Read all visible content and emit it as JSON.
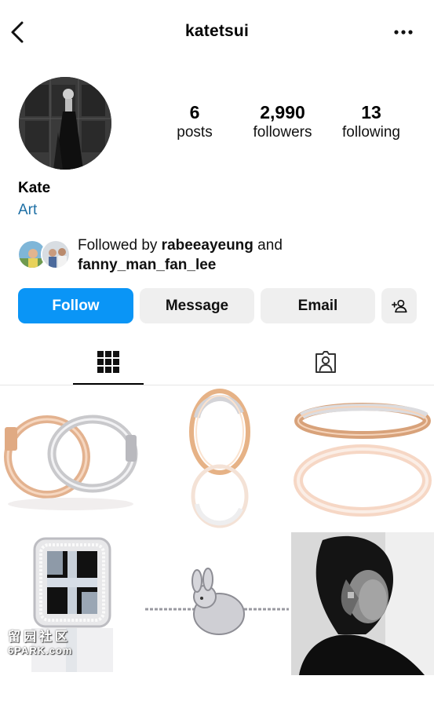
{
  "header": {
    "username": "katetsui",
    "back_icon": "chevron-left-icon",
    "more_icon": "more-horizontal-icon"
  },
  "profile": {
    "display_name": "Kate",
    "category": "Art",
    "stats": {
      "posts_count": "6",
      "posts_label": "posts",
      "followers_count": "2,990",
      "followers_label": "followers",
      "following_count": "13",
      "following_label": "following"
    }
  },
  "followed_by": {
    "prefix": "Followed by ",
    "user1": "rabeeayeung",
    "conjunction": " and",
    "user2": "fanny_man_fan_lee"
  },
  "actions": {
    "follow_label": "Follow",
    "message_label": "Message",
    "email_label": "Email",
    "add_user_icon": "person-add-icon"
  },
  "tabs": [
    {
      "name": "grid",
      "icon": "grid-icon",
      "active": true
    },
    {
      "name": "tagged",
      "icon": "tagged-person-icon",
      "active": false
    }
  ],
  "posts": [
    {
      "subject": "two rings"
    },
    {
      "subject": "single ring"
    },
    {
      "subject": "double band ring"
    },
    {
      "subject": "mosaic ring"
    },
    {
      "subject": "rabbit bracelet"
    },
    {
      "subject": "portrait"
    }
  ],
  "watermark": {
    "glyphs": "留园社区",
    "text": "6PARK.com"
  },
  "colors": {
    "follow_button": "#0a95f6",
    "secondary_button": "#efefef",
    "category_link": "#1d6fa5"
  }
}
